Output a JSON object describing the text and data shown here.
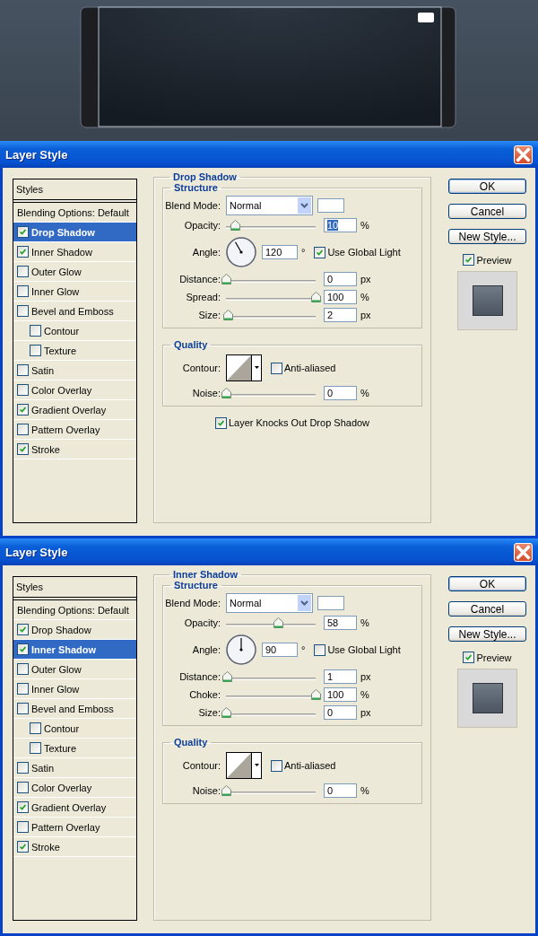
{
  "dialogs": [
    {
      "title": "Layer Style",
      "styles_header": "Styles",
      "styles": [
        {
          "label": "Blending Options: Default",
          "kind": "plain",
          "selected": false
        },
        {
          "label": "Drop Shadow",
          "kind": "check",
          "checked": true,
          "selected": true
        },
        {
          "label": "Inner Shadow",
          "kind": "check",
          "checked": true,
          "selected": false
        },
        {
          "label": "Outer Glow",
          "kind": "check",
          "checked": false,
          "selected": false
        },
        {
          "label": "Inner Glow",
          "kind": "check",
          "checked": false,
          "selected": false
        },
        {
          "label": "Bevel and Emboss",
          "kind": "check",
          "checked": false,
          "selected": false,
          "children": [
            {
              "label": "Contour",
              "kind": "check",
              "checked": false,
              "selected": false
            },
            {
              "label": "Texture",
              "kind": "check",
              "checked": false,
              "selected": false
            }
          ]
        },
        {
          "label": "Satin",
          "kind": "check",
          "checked": false,
          "selected": false
        },
        {
          "label": "Color Overlay",
          "kind": "check",
          "checked": false,
          "selected": false
        },
        {
          "label": "Gradient Overlay",
          "kind": "check",
          "checked": true,
          "selected": false
        },
        {
          "label": "Pattern Overlay",
          "kind": "check",
          "checked": false,
          "selected": false
        },
        {
          "label": "Stroke",
          "kind": "check",
          "checked": true,
          "selected": false
        }
      ],
      "panel": {
        "title": "Drop Shadow",
        "structure": {
          "title": "Structure",
          "blend_mode": {
            "label": "Blend Mode:",
            "value": "Normal"
          },
          "rows": [
            {
              "kind": "slider",
              "label": "Opacity:",
              "level": 0.1,
              "value": "10",
              "unit": "%",
              "highlighted": true
            },
            {
              "kind": "angle",
              "label": "Angle:",
              "value": "120",
              "unit": "°",
              "global_light": {
                "label": "Use Global Light",
                "checked": true
              }
            },
            {
              "kind": "slider",
              "label": "Distance:",
              "level": 0,
              "value": "0",
              "unit": "px",
              "highlighted": false
            },
            {
              "kind": "slider",
              "label": "Spread:",
              "level": 1,
              "value": "100",
              "unit": "%",
              "highlighted": false
            },
            {
              "kind": "slider",
              "label": "Size:",
              "level": 0.02,
              "value": "2",
              "unit": "px",
              "highlighted": false
            }
          ]
        },
        "quality": {
          "title": "Quality",
          "contour_label": "Contour:",
          "anti_aliased": {
            "label": "Anti-aliased",
            "checked": false
          },
          "noise": {
            "kind": "slider",
            "label": "Noise:",
            "level": 0,
            "value": "0",
            "unit": "%",
            "highlighted": false
          }
        },
        "knockout": {
          "label": "Layer Knocks Out Drop Shadow",
          "checked": true
        }
      },
      "buttons": [
        {
          "label": "OK",
          "default": true
        },
        {
          "label": "Cancel",
          "default": false
        },
        {
          "label": "New Style...",
          "default": false
        }
      ],
      "preview": {
        "label": "Preview",
        "checked": true
      }
    },
    {
      "title": "Layer Style",
      "styles_header": "Styles",
      "styles": [
        {
          "label": "Blending Options: Default",
          "kind": "plain",
          "selected": false
        },
        {
          "label": "Drop Shadow",
          "kind": "check",
          "checked": true,
          "selected": false
        },
        {
          "label": "Inner Shadow",
          "kind": "check",
          "checked": true,
          "selected": true
        },
        {
          "label": "Outer Glow",
          "kind": "check",
          "checked": false,
          "selected": false
        },
        {
          "label": "Inner Glow",
          "kind": "check",
          "checked": false,
          "selected": false
        },
        {
          "label": "Bevel and Emboss",
          "kind": "check",
          "checked": false,
          "selected": false,
          "children": [
            {
              "label": "Contour",
              "kind": "check",
              "checked": false,
              "selected": false
            },
            {
              "label": "Texture",
              "kind": "check",
              "checked": false,
              "selected": false
            }
          ]
        },
        {
          "label": "Satin",
          "kind": "check",
          "checked": false,
          "selected": false
        },
        {
          "label": "Color Overlay",
          "kind": "check",
          "checked": false,
          "selected": false
        },
        {
          "label": "Gradient Overlay",
          "kind": "check",
          "checked": true,
          "selected": false
        },
        {
          "label": "Pattern Overlay",
          "kind": "check",
          "checked": false,
          "selected": false
        },
        {
          "label": "Stroke",
          "kind": "check",
          "checked": true,
          "selected": false
        }
      ],
      "panel": {
        "title": "Inner Shadow",
        "structure": {
          "title": "Structure",
          "blend_mode": {
            "label": "Blend Mode:",
            "value": "Normal"
          },
          "rows": [
            {
              "kind": "slider",
              "label": "Opacity:",
              "level": 0.58,
              "value": "58",
              "unit": "%",
              "highlighted": false
            },
            {
              "kind": "angle",
              "label": "Angle:",
              "value": "90",
              "unit": "°",
              "global_light": {
                "label": "Use Global Light",
                "checked": false
              }
            },
            {
              "kind": "slider",
              "label": "Distance:",
              "level": 0.01,
              "value": "1",
              "unit": "px",
              "highlighted": false
            },
            {
              "kind": "slider",
              "label": "Choke:",
              "level": 1,
              "value": "100",
              "unit": "%",
              "highlighted": false
            },
            {
              "kind": "slider",
              "label": "Size:",
              "level": 0,
              "value": "0",
              "unit": "px",
              "highlighted": false
            }
          ]
        },
        "quality": {
          "title": "Quality",
          "contour_label": "Contour:",
          "anti_aliased": {
            "label": "Anti-aliased",
            "checked": false
          },
          "noise": {
            "kind": "slider",
            "label": "Noise:",
            "level": 0,
            "value": "0",
            "unit": "%",
            "highlighted": false
          }
        }
      },
      "buttons": [
        {
          "label": "OK",
          "default": true
        },
        {
          "label": "Cancel",
          "default": false
        },
        {
          "label": "New Style...",
          "default": false
        }
      ],
      "preview": {
        "label": "Preview",
        "checked": true
      }
    }
  ]
}
